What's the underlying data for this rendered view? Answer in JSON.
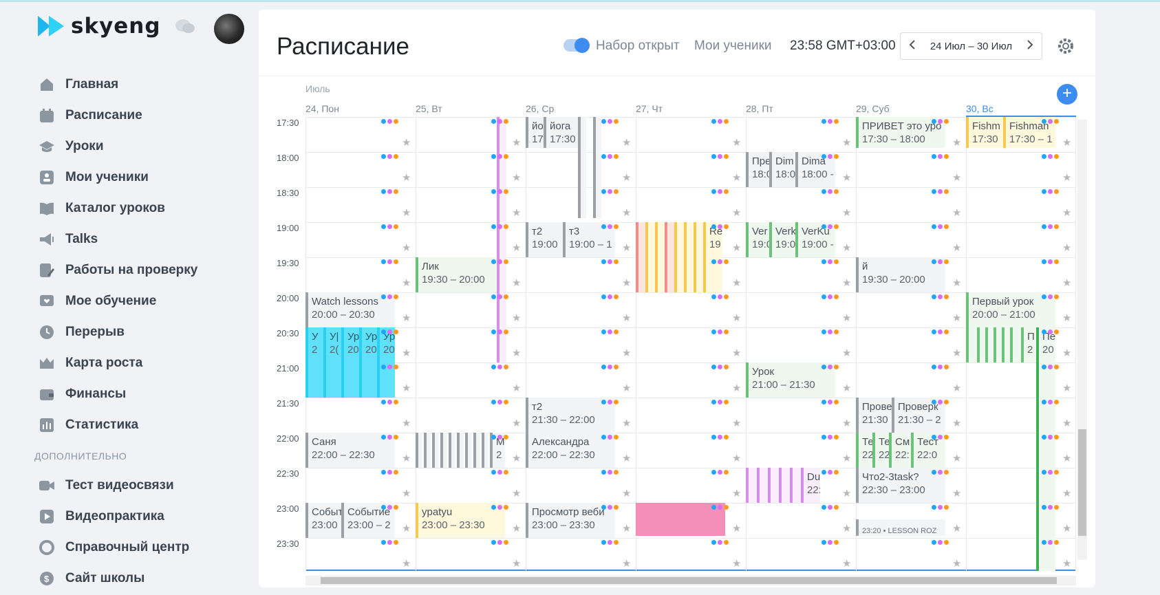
{
  "app": {
    "name": "skyeng"
  },
  "colors": {
    "accent": "#3f8cf0",
    "dot_blue": "#1fa4ff",
    "dot_purple": "#d96cf0",
    "dot_orange": "#ff9a1f"
  },
  "sidebar": {
    "items": [
      {
        "label": "Главная",
        "icon": "home-icon"
      },
      {
        "label": "Расписание",
        "icon": "calendar-icon"
      },
      {
        "label": "Уроки",
        "icon": "graduation-cap-icon"
      },
      {
        "label": "Мои ученики",
        "icon": "students-icon"
      },
      {
        "label": "Каталог уроков",
        "icon": "book-icon"
      },
      {
        "label": "Talks",
        "icon": "megaphone-icon"
      },
      {
        "label": "Работы на проверку",
        "icon": "edit-document-icon"
      },
      {
        "label": "Мое обучение",
        "icon": "heart-screen-icon"
      },
      {
        "label": "Перерыв",
        "icon": "clock-icon"
      },
      {
        "label": "Карта роста",
        "icon": "crown-icon"
      },
      {
        "label": "Финансы",
        "icon": "wallet-icon"
      },
      {
        "label": "Статистика",
        "icon": "bar-chart-icon"
      }
    ],
    "section_label": "ДОПОЛНИТЕЛЬНО",
    "extra_items": [
      {
        "label": "Тест видеосвязи",
        "icon": "video-camera-icon"
      },
      {
        "label": "Видеопрактика",
        "icon": "play-icon"
      },
      {
        "label": "Справочный центр",
        "icon": "lifebuoy-icon"
      },
      {
        "label": "Сайт школы",
        "icon": "dollar-icon"
      }
    ]
  },
  "header": {
    "title": "Расписание",
    "toggle_label": "Набор открыт",
    "toggle_on": true,
    "students_link": "Мои ученики",
    "clock": "23:58 GMT+03:00",
    "week_range": "24 Июл – 30 Июл"
  },
  "calendar": {
    "month": "Июль",
    "days": [
      "24, Пон",
      "25, Вт",
      "26, Ср",
      "27, Чт",
      "28, Пт",
      "29, Суб",
      "30, Вс"
    ],
    "today_index": 6,
    "times": [
      "17:30",
      "18:00",
      "18:30",
      "19:00",
      "19:30",
      "20:00",
      "20:30",
      "21:00",
      "21:30",
      "22:00",
      "22:30",
      "23:00",
      "23:30"
    ],
    "events": [
      {
        "title": "йо",
        "time": "17",
        "day": 2
      },
      {
        "title": "йога",
        "time": "17:30 -",
        "day": 2
      },
      {
        "title": "ПРИВЕТ это уро",
        "time": "17:30 – 18:00",
        "day": 5
      },
      {
        "title": "Fishm",
        "time": "17:30",
        "day": 6
      },
      {
        "title": "Fishman",
        "time": "17:30 – 1",
        "day": 6
      },
      {
        "title": "Пре",
        "time": "18:0",
        "day": 4
      },
      {
        "title": "Dim",
        "time": "18:0",
        "day": 4
      },
      {
        "title": "Dima",
        "time": "18:00 -",
        "day": 4
      },
      {
        "title": "т2",
        "time": "19:00",
        "day": 2
      },
      {
        "title": "т3",
        "time": "19:00 – 1",
        "day": 2
      },
      {
        "title": "Ver",
        "time": "19:0",
        "day": 4
      },
      {
        "title": "Verk",
        "time": "19:0",
        "day": 4
      },
      {
        "title": "VerKu",
        "time": "19:00 -",
        "day": 4
      },
      {
        "title": "Re",
        "time": "19",
        "day": 3
      },
      {
        "title": "Лик",
        "time": "19:30 – 20:00",
        "day": 1
      },
      {
        "title": "й",
        "time": "19:30 – 20:00",
        "day": 5
      },
      {
        "title": "Watch lessons",
        "time": "20:00 – 20:30",
        "day": 0
      },
      {
        "title": "Первый урок",
        "time": "20:00 – 21:00",
        "day": 6
      },
      {
        "title": "Урок",
        "time": "21:00 – 21:30",
        "day": 4
      },
      {
        "title": "т2",
        "time": "21:30 – 22:00",
        "day": 2
      },
      {
        "title": "Прове",
        "time": "21:30",
        "day": 5
      },
      {
        "title": "Проверк",
        "time": "21:30 – 2",
        "day": 5
      },
      {
        "title": "Саня",
        "time": "22:00 – 22:30",
        "day": 0
      },
      {
        "title": "Александра",
        "time": "22:00 – 22:30",
        "day": 2
      },
      {
        "title": "Те",
        "time": "22",
        "day": 5
      },
      {
        "title": "Те",
        "time": "22",
        "day": 5
      },
      {
        "title": "См",
        "time": "22:",
        "day": 5
      },
      {
        "title": "Тест",
        "time": "22:0",
        "day": 5
      },
      {
        "title": "Что2-3task?",
        "time": "22:30 – 23:00",
        "day": 5
      },
      {
        "title": "Du",
        "time": "22:",
        "day": 4
      },
      {
        "title": "Событ",
        "time": "23:00",
        "day": 0
      },
      {
        "title": "Событие",
        "time": "23:00 – 2",
        "day": 0
      },
      {
        "title": "ypatyu",
        "time": "23:00 – 23:30",
        "day": 1
      },
      {
        "title": "Просмотр веби",
        "time": "23:00 – 23:30",
        "day": 2
      },
      {
        "title": "23:20 • LESSON ROZ",
        "time": "",
        "day": 5
      },
      {
        "title": "У",
        "time": "2",
        "day": 0
      },
      {
        "title": "У|",
        "time": "2(",
        "day": 0
      },
      {
        "title": "Ур",
        "time": "20",
        "day": 0
      },
      {
        "title": "Ур",
        "time": "20",
        "day": 0
      },
      {
        "title": "Уро",
        "time": "20:",
        "day": 0
      },
      {
        "title": "П",
        "time": "2",
        "day": 6
      },
      {
        "title": "Пе",
        "time": "20",
        "day": 6
      },
      {
        "title": "М",
        "time": "2",
        "day": 1
      }
    ]
  }
}
